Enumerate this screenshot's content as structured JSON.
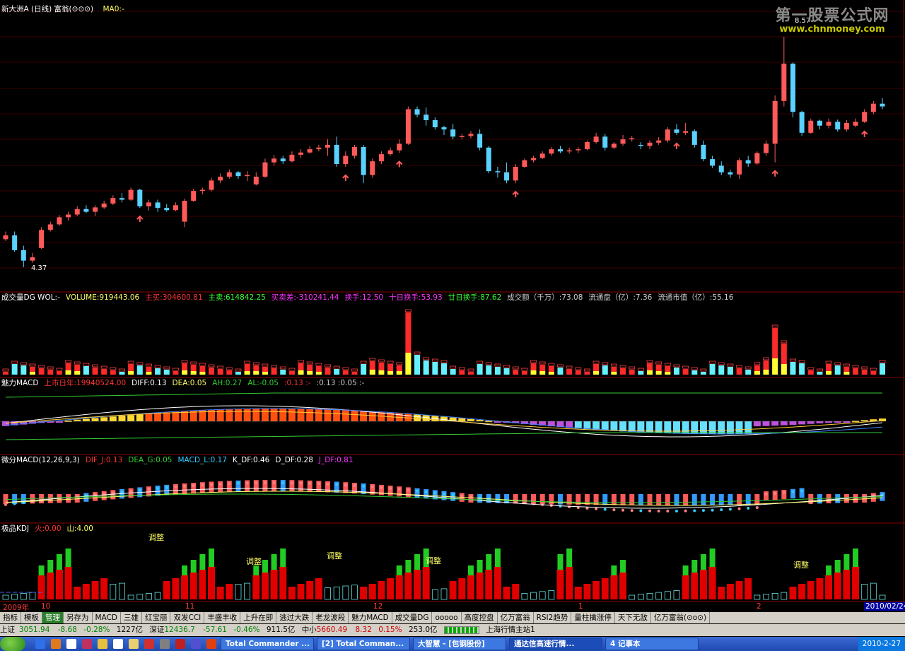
{
  "main_chart": {
    "title": "新大洲A (日线) 富翁(⊙⊙⊙)",
    "ma": "MA0:-",
    "label_low": "4.37",
    "label_high": "8.57"
  },
  "watermark": {
    "line1": "第一股票公式网",
    "line2": "www.chnmoney.com"
  },
  "volume_panel": {
    "name": "成交量DG WOL:-",
    "items": [
      {
        "text": "VOLUME:919443.06",
        "color": "#ffff66"
      },
      {
        "text": "主买:304600.81",
        "color": "#ff3333"
      },
      {
        "text": "主卖:614842.25",
        "color": "#33ff33"
      },
      {
        "text": "买卖差:-310241.44",
        "color": "#ff33ff"
      },
      {
        "text": "换手:12.50",
        "color": "#ff33ff"
      },
      {
        "text": "十日换手:53.93",
        "color": "#ff33ff"
      },
      {
        "text": "廿日换手:87.62",
        "color": "#33ff33"
      },
      {
        "text": "成交额（千万）:73.08",
        "color": "#cccccc"
      },
      {
        "text": "流通盘（亿）:7.36",
        "color": "#cccccc"
      },
      {
        "text": "流通市值（亿）:55.16",
        "color": "#cccccc"
      }
    ]
  },
  "macd_panel": {
    "name": "魅力MACD",
    "items": [
      {
        "text": "上市日年:19940524.00",
        "color": "#ff3333"
      },
      {
        "text": "DIFF:0.13",
        "color": "#ffffff"
      },
      {
        "text": "DEA:0.05",
        "color": "#ffff66"
      },
      {
        "text": "AH:0.27",
        "color": "#33cc33"
      },
      {
        "text": "AL:-0.05",
        "color": "#33cc33"
      },
      {
        "text": ":0.13 :-",
        "color": "#ff3333"
      },
      {
        "text": ":0.13 :0.05 :-",
        "color": "#cccccc"
      }
    ]
  },
  "diff_panel": {
    "name": "微分MACD(12,26,9,3)",
    "items": [
      {
        "text": "DIF_J:0.13",
        "color": "#ff3333"
      },
      {
        "text": "DEA_G:0.05",
        "color": "#33cc33"
      },
      {
        "text": "MACD_L:0.17",
        "color": "#33ccff"
      },
      {
        "text": "K_DF:0.46",
        "color": "#ffffff"
      },
      {
        "text": "D_DF:0.28",
        "color": "#ffffff"
      },
      {
        "text": "J_DF:0.81",
        "color": "#ff33ff"
      }
    ]
  },
  "kdj_panel": {
    "name": "极品KDJ",
    "items": [
      {
        "text": "火:0.00",
        "color": "#ff3333"
      },
      {
        "text": "山:4.00",
        "color": "#ffff66"
      }
    ],
    "annotation": "调整"
  },
  "time_axis": {
    "start_label": "2009年",
    "months": [
      "10",
      "11",
      "12",
      "1",
      "2"
    ],
    "end_label": "2010/02/24"
  },
  "tabs": [
    "指标",
    "模板",
    "管理",
    "另存为",
    "MACD",
    "三雄",
    "红宝丽",
    "双发CCI",
    "丰盛丰收",
    "上升在即",
    "逃过大跌",
    "老龙波段",
    "魅力MACD",
    "成交量DG",
    "ooooo",
    "高度控盘",
    "亿万富翁",
    "RSI2趋势",
    "量柱擒涨停",
    "天下无敌",
    "亿万富翁(⊙o⊙)"
  ],
  "active_tab": "管理",
  "status": {
    "sh": {
      "name": "上证",
      "value": "3051.94",
      "chg": "-8.68",
      "pct": "-0.28%",
      "amt": "1227亿"
    },
    "sz": {
      "name": "深证",
      "value": "12436.7",
      "chg": "-57.61",
      "pct": "-0.46%",
      "amt": "911.5亿"
    },
    "zx": {
      "name": "中小",
      "value": "5660.49",
      "chg": "8.32",
      "pct": "0.15%",
      "amt": "253.0亿"
    },
    "server": "上海行情主站1"
  },
  "taskbar": {
    "windows": [
      "Total Commander ...",
      "[2] Total Comman...",
      "大智慧 - [包钢股份]",
      "通达信高速行情...",
      "4 记事本"
    ],
    "clock": "2010-2-27"
  },
  "colors": {
    "up": "#ff5a5a",
    "down": "#5ad2ff",
    "grid": "#8a0000",
    "bg": "#000000"
  },
  "chart_data": {
    "type": "candlestick",
    "title": "新大洲A (日线)",
    "y_low": 4.37,
    "y_high": 8.57,
    "x_range": [
      "2009/09",
      "2010/02/24"
    ],
    "candles_ohlc": [
      [
        4.88,
        5.02,
        4.85,
        4.95
      ],
      [
        4.95,
        5.02,
        4.65,
        4.68
      ],
      [
        4.68,
        4.76,
        4.37,
        4.49
      ],
      [
        4.49,
        4.63,
        4.45,
        4.55
      ],
      [
        4.72,
        5.1,
        4.7,
        5.05
      ],
      [
        5.05,
        5.2,
        5.02,
        5.15
      ],
      [
        5.15,
        5.32,
        5.12,
        5.28
      ],
      [
        5.28,
        5.38,
        5.22,
        5.33
      ],
      [
        5.33,
        5.48,
        5.3,
        5.43
      ],
      [
        5.43,
        5.5,
        5.35,
        5.38
      ],
      [
        5.38,
        5.5,
        5.3,
        5.46
      ],
      [
        5.46,
        5.58,
        5.43,
        5.53
      ],
      [
        5.53,
        5.68,
        5.5,
        5.63
      ],
      [
        5.63,
        5.72,
        5.55,
        5.6
      ],
      [
        5.6,
        5.82,
        5.58,
        5.78
      ],
      [
        5.78,
        5.8,
        5.45,
        5.48
      ],
      [
        5.48,
        5.6,
        5.4,
        5.55
      ],
      [
        5.55,
        5.6,
        5.38,
        5.45
      ],
      [
        5.45,
        5.52,
        5.38,
        5.41
      ],
      [
        5.41,
        5.55,
        5.39,
        5.5
      ],
      [
        5.2,
        5.62,
        5.1,
        5.58
      ],
      [
        5.58,
        5.8,
        5.56,
        5.76
      ],
      [
        5.76,
        5.82,
        5.7,
        5.78
      ],
      [
        5.78,
        6.0,
        5.75,
        5.95
      ],
      [
        5.95,
        6.08,
        5.9,
        6.02
      ],
      [
        6.02,
        6.15,
        5.98,
        6.1
      ],
      [
        6.1,
        6.12,
        5.98,
        6.03
      ],
      [
        6.03,
        6.12,
        5.94,
        6.05
      ],
      [
        5.88,
        6.1,
        5.86,
        6.02
      ],
      [
        6.02,
        6.35,
        6.0,
        6.28
      ],
      [
        6.28,
        6.42,
        6.22,
        6.35
      ],
      [
        6.35,
        6.4,
        6.25,
        6.3
      ],
      [
        6.3,
        6.48,
        6.28,
        6.42
      ],
      [
        6.42,
        6.52,
        6.36,
        6.46
      ],
      [
        6.46,
        6.58,
        6.44,
        6.52
      ],
      [
        6.52,
        6.6,
        6.48,
        6.55
      ],
      [
        6.55,
        6.7,
        6.4,
        6.6
      ],
      [
        6.6,
        6.75,
        6.2,
        6.25
      ],
      [
        6.25,
        6.48,
        6.2,
        6.4
      ],
      [
        6.4,
        6.6,
        6.35,
        6.56
      ],
      [
        6.56,
        6.6,
        5.9,
        6.05
      ],
      [
        6.05,
        6.35,
        6.0,
        6.3
      ],
      [
        6.3,
        6.48,
        6.25,
        6.43
      ],
      [
        6.43,
        6.55,
        6.4,
        6.5
      ],
      [
        6.5,
        6.7,
        6.45,
        6.62
      ],
      [
        6.62,
        7.3,
        6.6,
        7.25
      ],
      [
        7.25,
        7.3,
        7.1,
        7.15
      ],
      [
        7.15,
        7.28,
        6.95,
        7.05
      ],
      [
        7.05,
        7.1,
        6.88,
        6.92
      ],
      [
        6.92,
        6.95,
        6.78,
        6.88
      ],
      [
        6.88,
        6.98,
        6.7,
        6.75
      ],
      [
        6.75,
        6.8,
        6.7,
        6.76
      ],
      [
        6.76,
        6.85,
        6.72,
        6.8
      ],
      [
        6.8,
        6.88,
        6.5,
        6.55
      ],
      [
        6.55,
        6.58,
        6.08,
        6.12
      ],
      [
        6.12,
        6.2,
        6.0,
        6.1
      ],
      [
        6.1,
        6.28,
        5.9,
        5.95
      ],
      [
        5.95,
        6.25,
        5.9,
        6.2
      ],
      [
        6.2,
        6.35,
        6.18,
        6.32
      ],
      [
        6.32,
        6.4,
        6.28,
        6.36
      ],
      [
        6.36,
        6.48,
        6.34,
        6.44
      ],
      [
        6.44,
        6.56,
        6.4,
        6.52
      ],
      [
        6.52,
        6.58,
        6.45,
        6.48
      ],
      [
        6.48,
        6.55,
        6.44,
        6.5
      ],
      [
        6.5,
        6.56,
        6.45,
        6.52
      ],
      [
        6.52,
        6.68,
        6.5,
        6.65
      ],
      [
        6.65,
        6.82,
        6.62,
        6.75
      ],
      [
        6.75,
        6.8,
        6.5,
        6.55
      ],
      [
        6.55,
        6.65,
        6.52,
        6.62
      ],
      [
        6.62,
        6.78,
        6.58,
        6.7
      ],
      [
        6.7,
        6.76,
        6.66,
        6.72
      ],
      [
        6.6,
        6.65,
        6.52,
        6.58
      ],
      [
        6.58,
        6.68,
        6.52,
        6.64
      ],
      [
        6.64,
        6.74,
        6.6,
        6.68
      ],
      [
        6.68,
        6.92,
        6.64,
        6.88
      ],
      [
        6.88,
        6.98,
        6.78,
        6.82
      ],
      [
        6.82,
        7.0,
        6.78,
        6.85
      ],
      [
        6.85,
        6.88,
        6.55,
        6.6
      ],
      [
        6.6,
        6.68,
        6.3,
        6.34
      ],
      [
        6.34,
        6.4,
        6.18,
        6.22
      ],
      [
        6.22,
        6.3,
        6.05,
        6.1
      ],
      [
        6.1,
        6.15,
        6.0,
        6.06
      ],
      [
        6.06,
        6.36,
        5.98,
        6.32
      ],
      [
        6.32,
        6.4,
        6.2,
        6.26
      ],
      [
        6.26,
        6.48,
        6.24,
        6.45
      ],
      [
        6.45,
        6.68,
        6.4,
        6.62
      ],
      [
        6.62,
        7.5,
        6.28,
        7.4
      ],
      [
        7.4,
        8.57,
        7.3,
        8.08
      ],
      [
        8.08,
        8.1,
        7.1,
        7.2
      ],
      [
        7.2,
        7.22,
        6.76,
        6.82
      ],
      [
        6.82,
        7.08,
        6.8,
        7.04
      ],
      [
        7.04,
        7.06,
        6.88,
        6.95
      ],
      [
        6.95,
        7.08,
        6.9,
        7.02
      ],
      [
        7.02,
        7.06,
        6.84,
        6.88
      ],
      [
        6.88,
        7.05,
        6.84,
        7.0
      ],
      [
        6.95,
        7.08,
        6.92,
        7.02
      ],
      [
        7.02,
        7.25,
        7.0,
        7.2
      ],
      [
        7.2,
        7.4,
        7.16,
        7.35
      ],
      [
        7.35,
        7.45,
        7.25,
        7.3
      ]
    ],
    "volume_last": 919443.06,
    "macd": {
      "DIFF": 0.13,
      "DEA": 0.05,
      "AH": 0.27,
      "AL": -0.05
    }
  }
}
